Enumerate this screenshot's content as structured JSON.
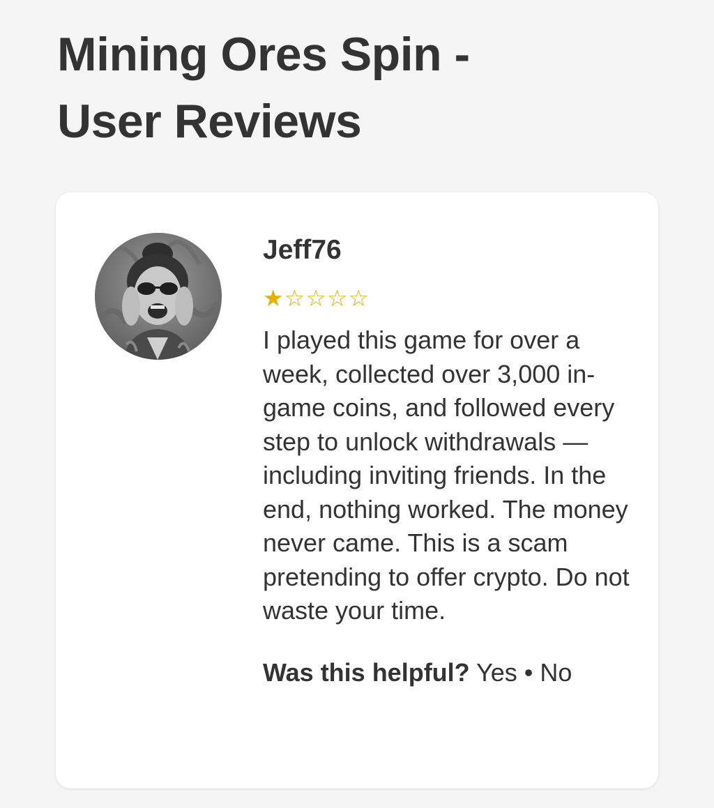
{
  "page": {
    "title_line1": "Mining Ores Spin -",
    "title_line2": "User Reviews"
  },
  "review": {
    "reviewer_name": "Jeff76",
    "rating": 1,
    "rating_max": 5,
    "stars": [
      "★",
      "☆",
      "☆",
      "☆",
      "☆"
    ],
    "text": "I played this game for over a week, collected over 3,000 in-game coins, and followed every step to unlock withdrawals — including inviting friends. In the end, nothing worked. The money never came. This is a scam pretending to offer crypto. Do not waste your time.",
    "helpful_prompt": "Was this helpful?",
    "yes_label": "Yes",
    "separator": "•",
    "no_label": "No",
    "avatar_icon": "user-photo-avatar",
    "star_color": "#e5b100"
  }
}
